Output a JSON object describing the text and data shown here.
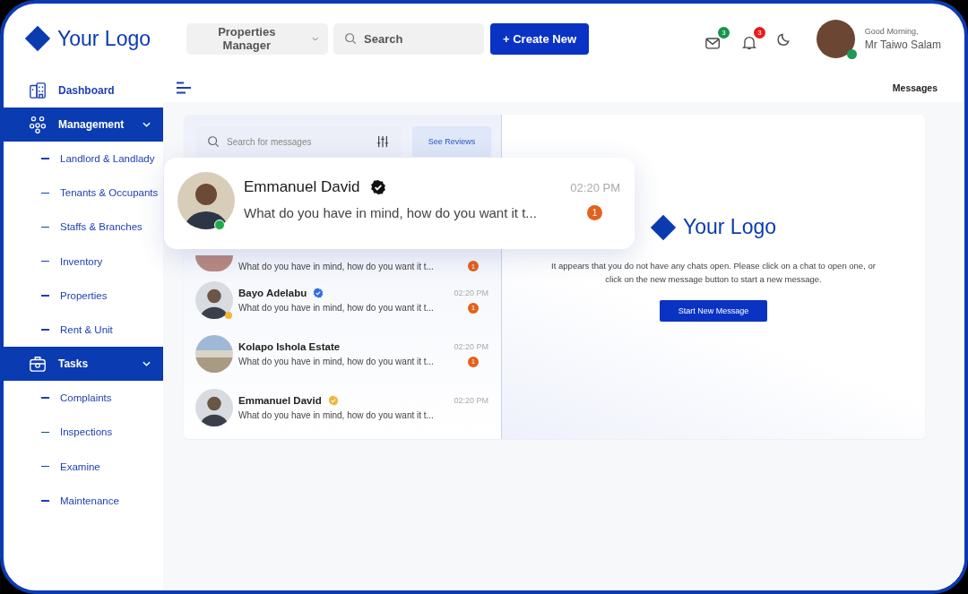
{
  "logo": {
    "text": "Your Logo"
  },
  "header": {
    "workspace": "Properties Manager",
    "search_placeholder": "Search",
    "create_button": "+ Create New",
    "mail_count": "3",
    "notification_count": "3",
    "greeting": "Good Morning,",
    "user_name": "Mr Taiwo Salam",
    "online": true
  },
  "sidebar": {
    "items": [
      {
        "label": "Dashboard",
        "kind": "link",
        "selected": false
      },
      {
        "label": "Management",
        "kind": "group",
        "selected": true,
        "expanded": true,
        "children": [
          {
            "label": "Landlord & Landlady"
          },
          {
            "label": "Tenants & Occupants"
          },
          {
            "label": "Staffs & Branches"
          },
          {
            "label": "Inventory"
          },
          {
            "label": "Properties"
          },
          {
            "label": "Rent & Unit"
          }
        ]
      },
      {
        "label": "Tasks",
        "kind": "group",
        "selected": true,
        "expanded": true,
        "children": [
          {
            "label": "Complaints"
          },
          {
            "label": "Inspections"
          },
          {
            "label": "Examine"
          },
          {
            "label": "Maintenance"
          }
        ]
      }
    ]
  },
  "breadcrumb": "Messages",
  "messages": {
    "search_placeholder": "Search for messages",
    "reviews_button": "See Reviews",
    "featured": {
      "name": "Emmanuel David",
      "verified": true,
      "color": "#111111",
      "message": "What do you have in mind, how do you want it t...",
      "time": "02:20 PM",
      "unread": "1",
      "online": true
    },
    "chats": [
      {
        "kind": "person",
        "message": "What do you have in mind, how do you want it t...",
        "unread": "1"
      },
      {
        "kind": "person",
        "name": "Bayo Adelabu",
        "verified": true,
        "color": "#2f6fe4",
        "status": {
          "color": "#f2b53a"
        },
        "message": "What do you have in mind, how do you want it t...",
        "time": "02:20 PM",
        "unread": "1"
      },
      {
        "kind": "building",
        "name": "Kolapo Ishola Estate",
        "verified": false,
        "message": "What do you have in mind, how do you want it t...",
        "time": "02:20 PM",
        "unread": "1"
      },
      {
        "kind": "person",
        "name": "Emmanuel David",
        "verified": true,
        "color": "#f2b53a",
        "message": "What do you have in mind, how do you want it t...",
        "time": "02:20 PM"
      }
    ],
    "empty_state": {
      "logo": "Your Logo",
      "text": "It appears that you do not have any chats open. Please click on a chat to open one, or click on the new message button to start a new message.",
      "button": "Start New Message"
    }
  }
}
